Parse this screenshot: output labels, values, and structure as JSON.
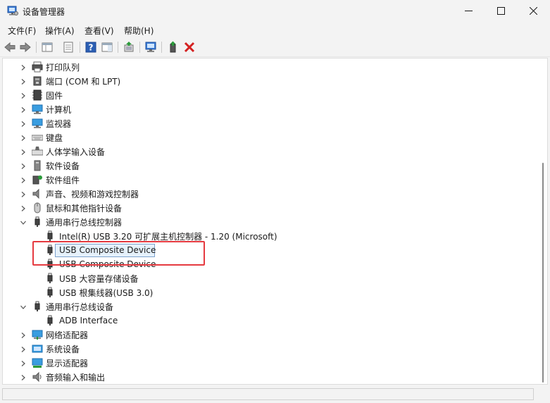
{
  "window": {
    "title": "设备管理器",
    "controls": {
      "minimize": "minimize-icon",
      "maximize": "maximize-icon",
      "close": "close-icon"
    }
  },
  "menu": {
    "items": [
      {
        "label": "文件(F)"
      },
      {
        "label": "操作(A)"
      },
      {
        "label": "查看(V)"
      },
      {
        "label": "帮助(H)"
      }
    ]
  },
  "toolbar": {
    "buttons": [
      "back-icon",
      "forward-icon",
      "properties-grid-icon",
      "properties-page-icon",
      "help-icon",
      "action-pane-icon",
      "update-driver-icon",
      "scan-hardware-icon",
      "enable-device-icon",
      "uninstall-icon"
    ],
    "accent": {
      "help_blue": "#2b5fb4",
      "remove_red": "#d42020",
      "update_green": "#2a9a3a"
    }
  },
  "tree": {
    "rows": [
      {
        "label": "打印队列",
        "icon": "printer-icon",
        "expanded": false
      },
      {
        "label": "端口 (COM 和 LPT)",
        "icon": "port-icon",
        "expanded": false
      },
      {
        "label": "固件",
        "icon": "firmware-icon",
        "expanded": false
      },
      {
        "label": "计算机",
        "icon": "computer-icon",
        "expanded": false
      },
      {
        "label": "监视器",
        "icon": "monitor-icon",
        "expanded": false
      },
      {
        "label": "键盘",
        "icon": "keyboard-icon",
        "expanded": false
      },
      {
        "label": "人体学输入设备",
        "icon": "hid-icon",
        "expanded": false
      },
      {
        "label": "软件设备",
        "icon": "software-device-icon",
        "expanded": false
      },
      {
        "label": "软件组件",
        "icon": "software-component-icon",
        "expanded": false
      },
      {
        "label": "声音、视频和游戏控制器",
        "icon": "speaker-icon",
        "expanded": false
      },
      {
        "label": "鼠标和其他指针设备",
        "icon": "mouse-icon",
        "expanded": false
      },
      {
        "label": "通用串行总线控制器",
        "icon": "usb-icon",
        "expanded": true
      },
      {
        "label": "Intel(R) USB 3.20 可扩展主机控制器 - 1.20 (Microsoft)",
        "icon": "usb-icon",
        "child": true
      },
      {
        "label": "USB Composite Device",
        "icon": "usb-icon",
        "child": true,
        "selected": true
      },
      {
        "label": "USB Composite Device",
        "icon": "usb-icon",
        "child": true
      },
      {
        "label": "USB 大容量存储设备",
        "icon": "usb-icon",
        "child": true
      },
      {
        "label": "USB 根集线器(USB 3.0)",
        "icon": "usb-icon",
        "child": true
      },
      {
        "label": "通用串行总线设备",
        "icon": "usb-icon",
        "expanded": true
      },
      {
        "label": "ADB Interface",
        "icon": "usb-icon",
        "child": true
      },
      {
        "label": "网络适配器",
        "icon": "network-icon",
        "expanded": false
      },
      {
        "label": "系统设备",
        "icon": "system-device-icon",
        "expanded": false
      },
      {
        "label": "显示适配器",
        "icon": "display-adapter-icon",
        "expanded": false
      },
      {
        "label": "音频输入和输出",
        "icon": "audio-io-icon",
        "expanded": false
      }
    ],
    "selection_color": "#e5f1fb",
    "highlight_color": "#e53a40"
  }
}
